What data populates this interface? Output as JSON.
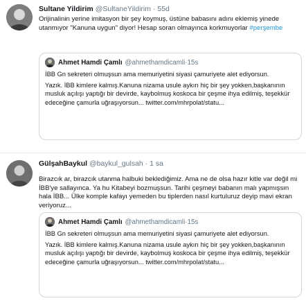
{
  "tweets": [
    {
      "author": {
        "name": "Sultane Yildirim",
        "handle": "@SultaneYildirim",
        "sep": "·",
        "time": "55d"
      },
      "text": "Orijinalinin yerine imitasyon bir şey koymuş, üstüne babasını adını eklemiş yinede utanmıyor \"Kanuna uygun\" diyor! Hesap soran olmayınca korkmuyorlar ",
      "hashtag": "#perşembe",
      "quote": {
        "author": {
          "name": "Ahmet Hamdi Çamlı",
          "handle": "@ahmethamdicamli",
          "sep": "·",
          "time": "15s"
        },
        "paragraphs": [
          "İBB Gn sekreteri olmuşsun ama memuriyetini siyasi çamuriyete alet ediyorsun.",
          "Yazık. İBB kimlere kalmış.Kanuna nizama usule aykırı hiç bir şey yokken,başkanının musluk açılışı yaptığı bir devirde, kaybolmuş koskoca bir çeşme ihya edilmiş, teşekkür edeceğine çamurla uğraşıyorsun... twitter.com/mhrpolat/statu..."
        ]
      }
    },
    {
      "author": {
        "name": "GülşahBaykul",
        "handle": "@baykul_gulsah",
        "sep": "·",
        "time": "1 sa"
      },
      "text": "Birazcık ar, birazcık utanma halbuki beklediğimiz. Ama ne de olsa hazır kitle var değil mi İBB'ye sallayınca. Ya hu Kitabeyi bozmuşsun. Tarihi çeşmeyi babanın malı yapmışsın hala İBB... Ülke komple kafayı yemeden bu tiplerden nasıl kurtuluruz deyip mavi ekran veriyoruz...",
      "quote": {
        "author": {
          "name": "Ahmet Hamdi Çamlı",
          "handle": "@ahmethamdicamli",
          "sep": "·",
          "time": "15s"
        },
        "paragraphs": [
          "İBB Gn sekreteri olmuşsun ama memuriyetini siyasi çamuriyete alet ediyorsun.",
          "Yazık. İBB kimlere kalmış.Kanuna nizama usule aykırı hiç bir şey yokken,başkanının musluk açılışı yaptığı bir devirde, kaybolmuş koskoca bir çeşme ihya edilmiş, teşekkür edeceğine çamurla uğraşıyorsun... twitter.com/mhrpolat/statu..."
        ]
      }
    }
  ]
}
